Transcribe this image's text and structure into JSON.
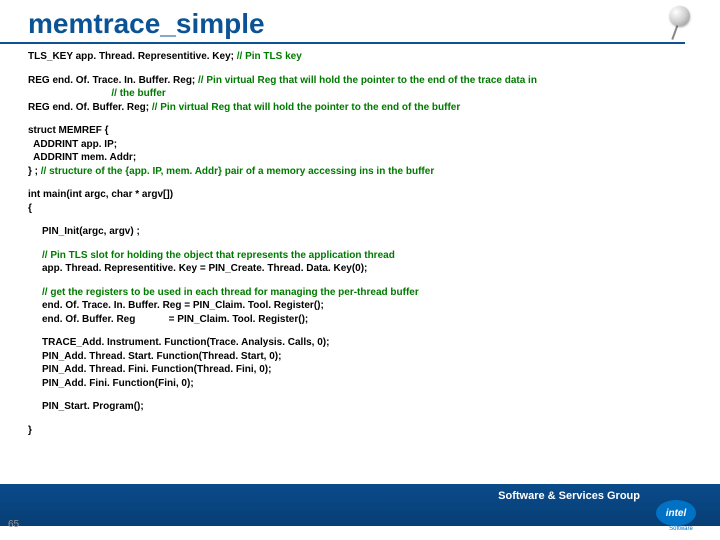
{
  "title": "memtrace_simple",
  "lines": {
    "l1a": "TLS_KEY app. Thread. Representitive. Key; ",
    "l1c": "// Pin TLS key",
    "l2a": "REG end. Of. Trace. In. Buffer. Reg; ",
    "l2c": "// Pin virtual Reg that will hold the pointer to the end of the trace data in",
    "l2c2": "// the buffer",
    "l3a": "REG end. Of. Buffer. Reg; ",
    "l3c": "// Pin virtual Reg that will hold the pointer to the end of the buffer",
    "s1": "struct MEMREF {",
    "s2": "  ADDRINT app. IP;",
    "s3": "  ADDRINT mem. Addr;",
    "s4": "} ; ",
    "s4c": "// structure of the {app. IP, mem. Addr} pair of a memory accessing ins in the buffer",
    "m1": "int main(int argc, char * argv[])",
    "m2": "{",
    "m3": "PIN_Init(argc, argv) ;",
    "m4c": "// Pin TLS slot for holding the object that represents the application thread",
    "m5": "app. Thread. Representitive. Key = PIN_Create. Thread. Data. Key(0);",
    "m6c": "// get the registers to be used in each thread for managing the per-thread buffer",
    "m7": "end. Of. Trace. In. Buffer. Reg = PIN_Claim. Tool. Register();",
    "m8": "end. Of. Buffer. Reg            = PIN_Claim. Tool. Register();",
    "m9": "TRACE_Add. Instrument. Function(Trace. Analysis. Calls, 0);",
    "m10": "PIN_Add. Thread. Start. Function(Thread. Start, 0);",
    "m11": "PIN_Add. Thread. Fini. Function(Thread. Fini, 0);",
    "m12": "PIN_Add. Fini. Function(Fini, 0);",
    "m13": "PIN_Start. Program();",
    "m14": "}"
  },
  "footer": {
    "label": "Software & Services Group",
    "slide_num": "65",
    "logo_text": "intel",
    "logo_sub": "Software"
  }
}
